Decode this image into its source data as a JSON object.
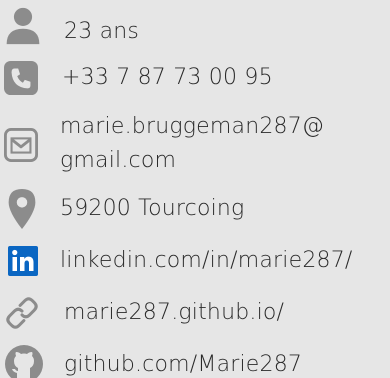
{
  "contact": {
    "age": "23 ans",
    "phone": "+33 7 87 73 00 95",
    "email_line1": "marie.bruggeman287@",
    "email_line2": "gmail.com",
    "location": "59200 Tourcoing",
    "linkedin": "linkedin.com/in/marie287/",
    "website": "marie287.github.io/",
    "github": "github.com/Marie287"
  },
  "icons": {
    "age": "person-icon",
    "phone": "phone-icon",
    "email": "envelope-icon",
    "location": "map-pin-icon",
    "linkedin": "linkedin-icon",
    "website": "link-icon",
    "github": "github-icon"
  },
  "colors": {
    "background": "#e6e6e6",
    "icon_gray": "#8c8c8c",
    "linkedin_blue": "#0a66c2",
    "text": "#2a2a2a"
  }
}
